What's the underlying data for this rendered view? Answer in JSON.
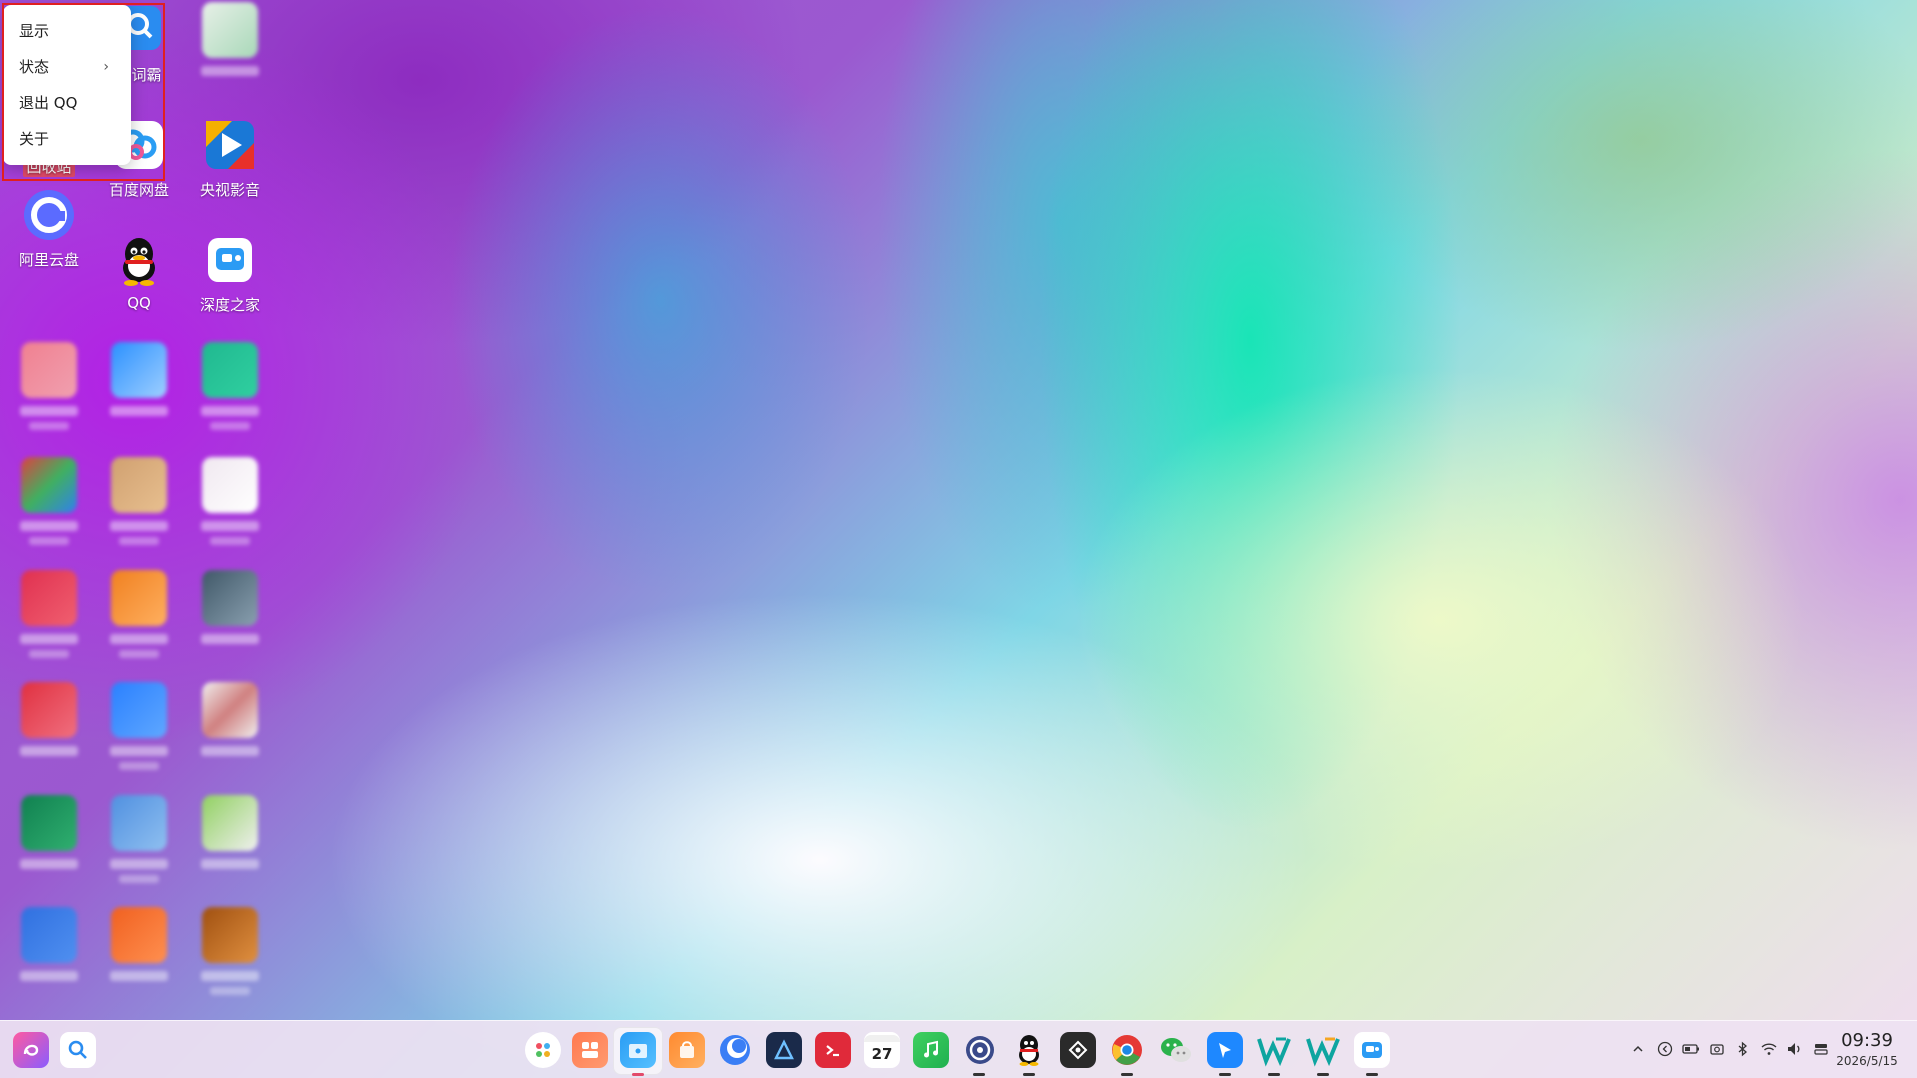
{
  "context_menu": {
    "items": [
      {
        "label": "显示"
      },
      {
        "label": "状态",
        "submenu_arrow": "›"
      },
      {
        "label": "退出 QQ"
      },
      {
        "label": "关于"
      }
    ]
  },
  "desktop": {
    "icons": [
      {
        "label": "回收站",
        "icon": "trash-icon"
      },
      {
        "label": "山词霸",
        "icon": "dictionary-icon"
      },
      {
        "label": "百度网盘",
        "icon": "baidu-netdisk-icon"
      },
      {
        "label": "央视影音",
        "icon": "cctv-video-icon"
      },
      {
        "label": "阿里云盘",
        "icon": "aliyun-drive-icon"
      },
      {
        "label": "QQ",
        "icon": "qq-icon"
      },
      {
        "label": "深度之家",
        "icon": "deepin-home-icon"
      }
    ],
    "colors": {
      "selected_label_bg": "#e24a6a",
      "menu_highlight_border": "#e02020"
    }
  },
  "taskbar": {
    "left": [
      {
        "icon": "launcher-icon"
      },
      {
        "icon": "search-icon"
      }
    ],
    "apps": [
      {
        "icon": "multitask-icon"
      },
      {
        "icon": "workspace-icon"
      },
      {
        "icon": "file-manager-icon"
      },
      {
        "icon": "app-store-icon"
      },
      {
        "icon": "browser-icon"
      },
      {
        "icon": "editor-icon"
      },
      {
        "icon": "terminal-icon"
      },
      {
        "icon": "calendar-icon",
        "text": "27"
      },
      {
        "icon": "music-icon"
      },
      {
        "icon": "settings-icon"
      },
      {
        "icon": "qq-icon"
      },
      {
        "icon": "app-icon"
      },
      {
        "icon": "chrome-icon"
      },
      {
        "icon": "wechat-icon"
      },
      {
        "icon": "feishu-icon"
      },
      {
        "icon": "wps-icon"
      },
      {
        "icon": "wps-icon-2"
      },
      {
        "icon": "deepin-home-icon"
      }
    ],
    "tray": [
      {
        "icon": "chevron-up-icon"
      },
      {
        "icon": "input-method-icon"
      },
      {
        "icon": "battery-icon"
      },
      {
        "icon": "screenshot-icon"
      },
      {
        "icon": "bluetooth-icon"
      },
      {
        "icon": "wifi-icon"
      },
      {
        "icon": "volume-icon"
      },
      {
        "icon": "notification-icon"
      }
    ],
    "clock": {
      "time": "09:39",
      "date": "2026/5/15"
    }
  }
}
